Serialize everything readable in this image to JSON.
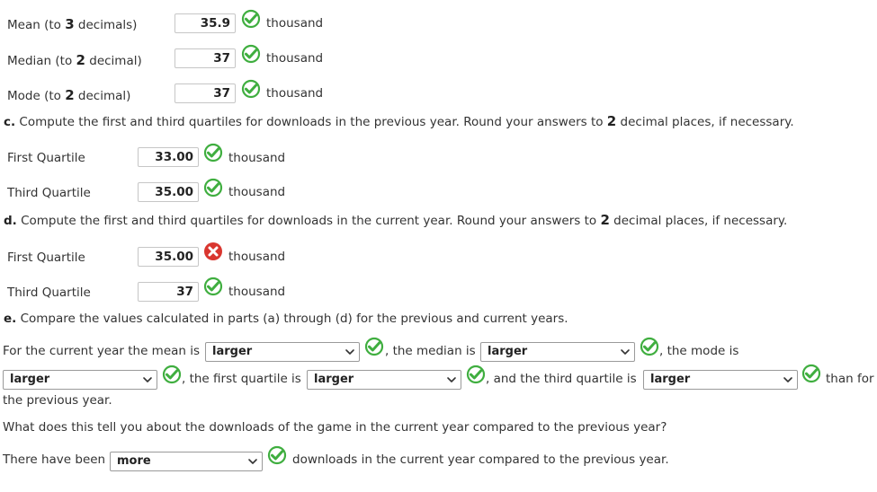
{
  "rows": [
    {
      "label_pre": "Mean (to ",
      "label_num": "3",
      "label_post": " decimals)",
      "value": "35.9",
      "status": "correct",
      "unit": "thousand"
    },
    {
      "label_pre": "Median (to ",
      "label_num": "2",
      "label_post": " decimal)",
      "value": "37",
      "status": "correct",
      "unit": "thousand"
    },
    {
      "label_pre": "Mode (to ",
      "label_num": "2",
      "label_post": " decimal)",
      "value": "37",
      "status": "correct",
      "unit": "thousand"
    }
  ],
  "part_c": {
    "letter": "c.",
    "text_pre": " Compute the first and third quartiles for downloads in the previous year. Round your answers to ",
    "num": "2",
    "text_post": " decimal places, if necessary.",
    "rows": [
      {
        "label": "First Quartile",
        "value": "33.00",
        "status": "correct",
        "unit": "thousand"
      },
      {
        "label": "Third Quartile",
        "value": "35.00",
        "status": "correct",
        "unit": "thousand"
      }
    ]
  },
  "part_d": {
    "letter": "d.",
    "text_pre": " Compute the first and third quartiles for downloads in the current year. Round your answers to ",
    "num": "2",
    "text_post": " decimal places, if necessary.",
    "rows": [
      {
        "label": "First Quartile",
        "value": "35.00",
        "status": "incorrect",
        "unit": "thousand"
      },
      {
        "label": "Third Quartile",
        "value": "37",
        "status": "correct",
        "unit": "thousand"
      }
    ]
  },
  "part_e": {
    "letter": "e.",
    "text": " Compare the values calculated in parts (a) through (d) for the previous and current years.",
    "s1": "For the current year the mean is",
    "mean_sel": "larger",
    "s2": ", the median is",
    "median_sel": "larger",
    "s3": ", the mode is",
    "mode_sel": "larger",
    "s4": ", the first quartile is",
    "q1_sel": "larger",
    "s5": ", and the third quartile is",
    "q3_sel": "larger",
    "s6": "than for",
    "s7": "the previous year.",
    "question": "What does this tell you about the downloads of the game in the current year compared to the previous year?",
    "s8": "There have been",
    "more_sel": "more",
    "s9": "downloads in the current year compared to the previous year."
  },
  "colors": {
    "correct": "#3fae3f",
    "incorrect": "#d9362f",
    "text": "#333333"
  }
}
